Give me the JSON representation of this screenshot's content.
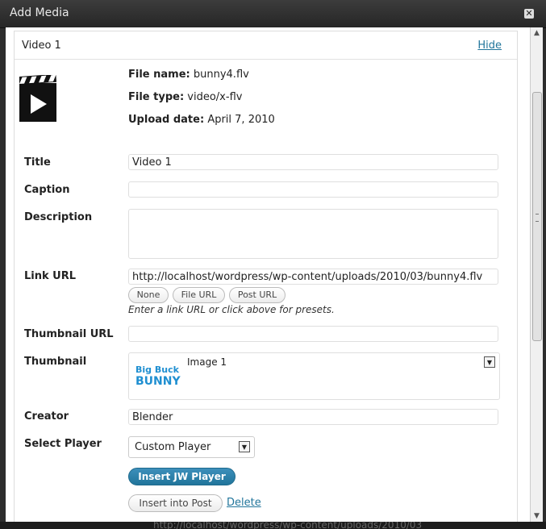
{
  "window": {
    "title": "Add Media",
    "close_icon": "close-icon"
  },
  "panel": {
    "name": "Video 1",
    "hide_link": "Hide"
  },
  "file": {
    "name_label": "File name:",
    "name_value": "bunny4.flv",
    "type_label": "File type:",
    "type_value": "video/x-flv",
    "date_label": "Upload date:",
    "date_value": "April 7, 2010"
  },
  "form": {
    "title_label": "Title",
    "title_value": "Video 1",
    "caption_label": "Caption",
    "caption_value": "",
    "description_label": "Description",
    "description_value": "",
    "link_label": "Link URL",
    "link_value": "http://localhost/wordpress/wp-content/uploads/2010/03/bunny4.flv",
    "link_buttons": [
      "None",
      "File URL",
      "Post URL"
    ],
    "link_hint": "Enter a link URL or click above for presets.",
    "thumb_url_label": "Thumbnail URL",
    "thumb_url_value": "",
    "thumbnail_label": "Thumbnail",
    "thumbnail_image_name": "Image 1",
    "thumbnail_logo_line1": "Big Buck",
    "thumbnail_logo_line2": "BUNNY",
    "creator_label": "Creator",
    "creator_value": "Blender",
    "player_label": "Select Player",
    "player_value": "Custom Player"
  },
  "actions": {
    "insert_jw": "Insert JW Player",
    "insert_post": "Insert into Post",
    "delete": "Delete"
  },
  "background_text": "http://localhost/wordpress/wp-content/uploads/2010/03",
  "colors": {
    "link": "#21759b",
    "primary_button": "#21759b",
    "titlebar": "#2d2d2d"
  }
}
